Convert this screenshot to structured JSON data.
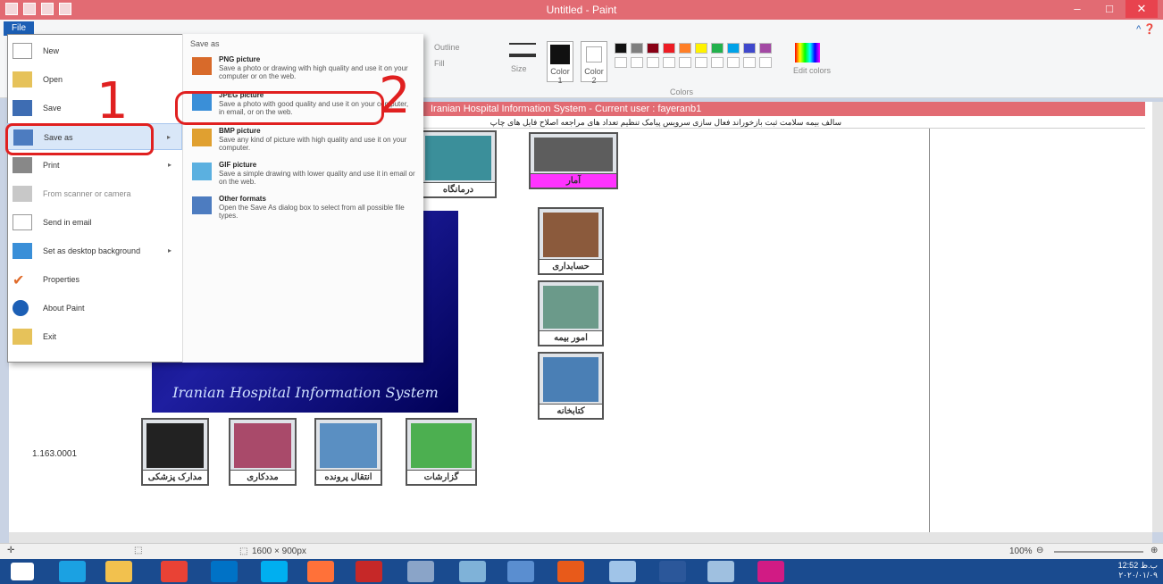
{
  "window": {
    "title": "Untitled - Paint"
  },
  "ribbon": {
    "file_tab": "File",
    "outline": "Outline",
    "fill": "Fill",
    "size": "Size",
    "color1": "Color 1",
    "color2": "Color 2",
    "edit_colors": "Edit colors",
    "colors_group": "Colors",
    "palette": [
      "#111111",
      "#7f7f7f",
      "#880015",
      "#ed1c24",
      "#ff7f27",
      "#fff200",
      "#22b14c",
      "#00a2e8",
      "#3f48cc",
      "#a349a4"
    ]
  },
  "file_menu": {
    "items": [
      {
        "label": "New",
        "icon": "new-file-icon"
      },
      {
        "label": "Open",
        "icon": "open-folder-icon"
      },
      {
        "label": "Save",
        "icon": "save-disk-icon"
      },
      {
        "label": "Save as",
        "icon": "save-as-icon",
        "selected": true
      },
      {
        "label": "Print",
        "icon": "printer-icon"
      },
      {
        "label": "From scanner or camera",
        "icon": "scanner-icon"
      },
      {
        "label": "Send in email",
        "icon": "email-icon"
      },
      {
        "label": "Set as desktop background",
        "icon": "desktop-icon"
      },
      {
        "label": "Properties",
        "icon": "checkmark-icon"
      },
      {
        "label": "About Paint",
        "icon": "info-icon"
      },
      {
        "label": "Exit",
        "icon": "exit-icon"
      }
    ],
    "save_as_header": "Save as",
    "save_as_options": [
      {
        "title": "PNG picture",
        "desc": "Save a photo or drawing with high quality and use it on your computer or on the web."
      },
      {
        "title": "JPEG picture",
        "desc": "Save a photo with good quality and use it on your computer, in email, or on the web."
      },
      {
        "title": "BMP picture",
        "desc": "Save any kind of picture with high quality and use it on your computer."
      },
      {
        "title": "GIF picture",
        "desc": "Save a simple drawing with lower quality and use it in email or on the web."
      },
      {
        "title": "Other formats",
        "desc": "Open the Save As dialog box to select from all possible file types."
      }
    ]
  },
  "annotations": {
    "step1": "1",
    "step2": "2"
  },
  "his": {
    "title": "Iranian Hospital Information System - Current user : fayeranb1",
    "menu": "سالف بیمه سلامت   ثبت بازخوراند   فعال سازی سرویس پیامک   تنظیم تعداد های مراجعه   اصلاح فایل های چاپ",
    "banner": "Iranian Hospital Information System",
    "version": "1.163.0001",
    "tiles": [
      "درمانگاه",
      "آمار",
      "حسابداری",
      "امور بیمه",
      "کتابخانه",
      "مدارک پزشکی",
      "مددکاری",
      "انتقال پرونده",
      "گزارشات"
    ]
  },
  "status": {
    "dimensions": "1600 × 900px",
    "zoom": "100%"
  },
  "tray": {
    "time": "12:52 ب.ظ",
    "date": "۲۰۲۰/۰۱/۰۹"
  }
}
